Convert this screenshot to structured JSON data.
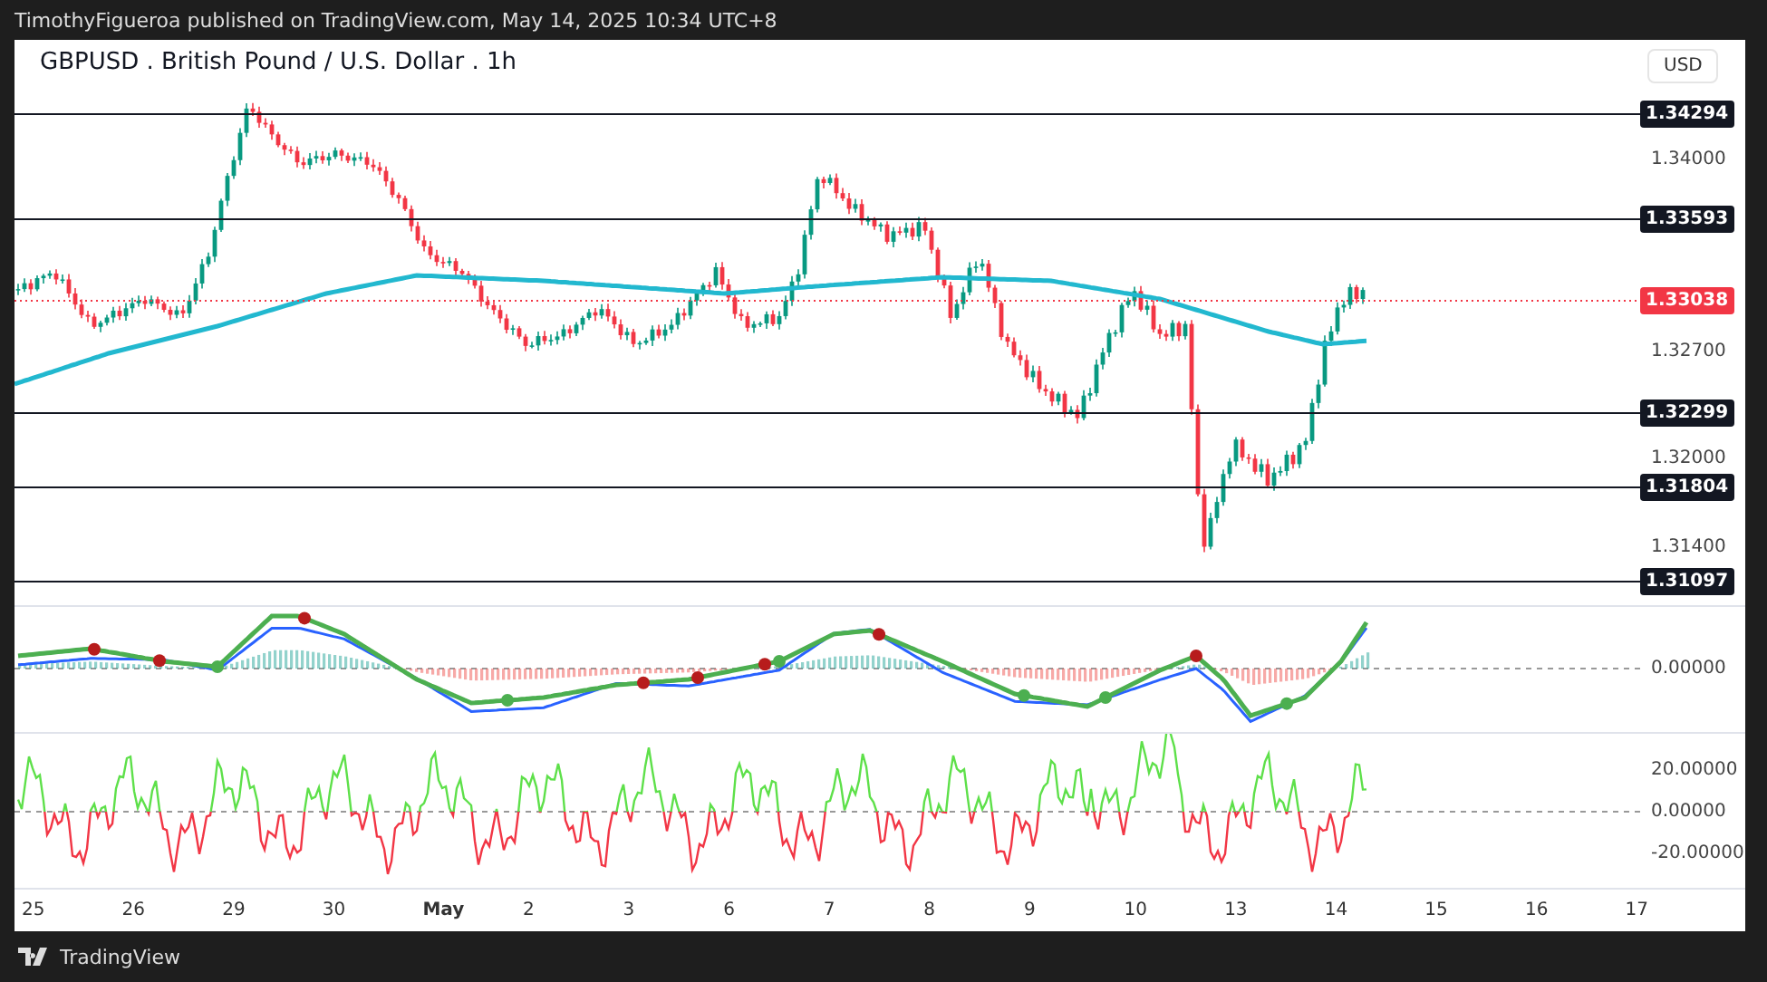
{
  "header": {
    "published": "TimothyFigueroa published on TradingView.com, May 14, 2025 10:34 UTC+8"
  },
  "chart": {
    "title": "GBPUSD . British Pound / U.S. Dollar . 1h",
    "currency": "USD"
  },
  "price_axis": {
    "ticks": [
      "1.34000",
      "1.32700",
      "1.32000",
      "1.31400"
    ]
  },
  "levels": [
    {
      "label": "1.34294"
    },
    {
      "label": "1.33593"
    },
    {
      "label": "1.32299"
    },
    {
      "label": "1.31804"
    },
    {
      "label": "1.31097"
    }
  ],
  "current_price": {
    "label": "1.33038"
  },
  "macd_axis": {
    "ticks": [
      "0.00000"
    ]
  },
  "oscillator_axis": {
    "ticks": [
      "20.00000",
      "0.00000",
      "-20.00000"
    ]
  },
  "time_axis": [
    {
      "label": "25",
      "kind": "day"
    },
    {
      "label": "26",
      "kind": "day"
    },
    {
      "label": "29",
      "kind": "day"
    },
    {
      "label": "30",
      "kind": "day"
    },
    {
      "label": "May",
      "kind": "month"
    },
    {
      "label": "2",
      "kind": "day"
    },
    {
      "label": "3",
      "kind": "day"
    },
    {
      "label": "6",
      "kind": "day"
    },
    {
      "label": "7",
      "kind": "day"
    },
    {
      "label": "8",
      "kind": "day"
    },
    {
      "label": "9",
      "kind": "day"
    },
    {
      "label": "10",
      "kind": "day"
    },
    {
      "label": "13",
      "kind": "day"
    },
    {
      "label": "14",
      "kind": "day"
    },
    {
      "label": "15",
      "kind": "day"
    },
    {
      "label": "16",
      "kind": "day"
    },
    {
      "label": "17",
      "kind": "day"
    }
  ],
  "footer": {
    "brand": "TradingView"
  }
}
